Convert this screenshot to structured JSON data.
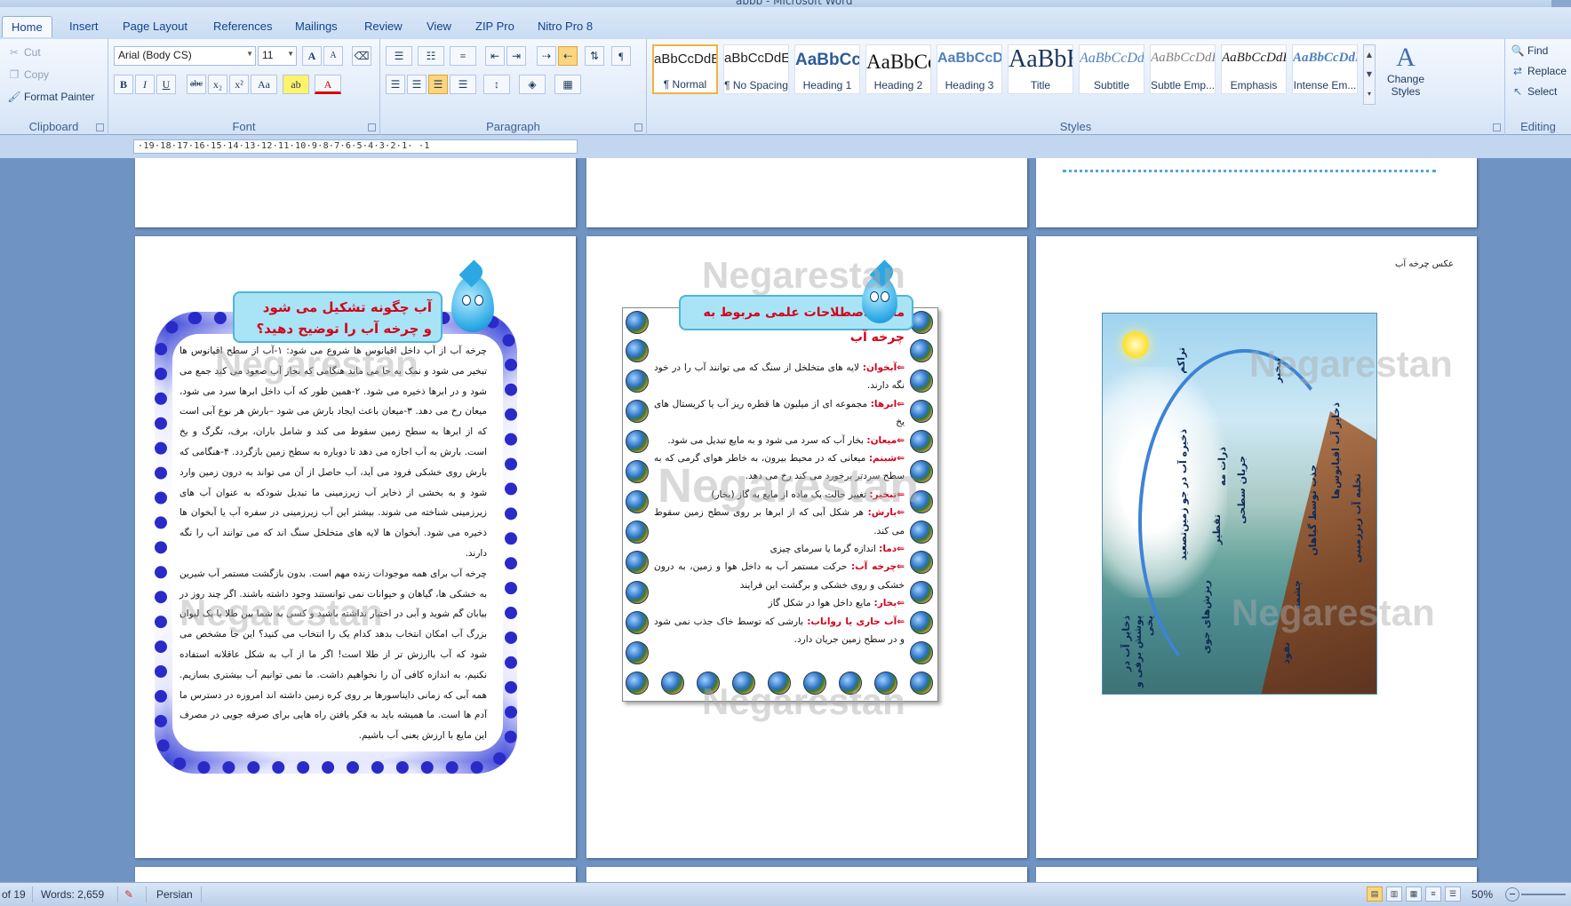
{
  "window": {
    "title": "abbb - Microsoft Word"
  },
  "tabs": [
    {
      "label": "Home",
      "active": true
    },
    {
      "label": "Insert"
    },
    {
      "label": "Page Layout"
    },
    {
      "label": "References"
    },
    {
      "label": "Mailings"
    },
    {
      "label": "Review"
    },
    {
      "label": "View"
    },
    {
      "label": "ZIP Pro"
    },
    {
      "label": "Nitro Pro 8"
    }
  ],
  "clipboard": {
    "label": "Clipboard",
    "cut": "Cut",
    "copy": "Copy",
    "format_painter": "Format Painter"
  },
  "font": {
    "label": "Font",
    "name": "Arial (Body CS)",
    "size": "11",
    "grow": "A",
    "shrink": "A",
    "clear": "⌫",
    "bold": "B",
    "italic": "I",
    "underline": "U",
    "strike": "abc",
    "subscript": "x₂",
    "superscript": "x²",
    "case": "Aa",
    "highlight": "ab",
    "color": "A"
  },
  "paragraph": {
    "label": "Paragraph"
  },
  "styles": {
    "label": "Styles",
    "items": [
      {
        "sample": "aBbCcDdEe",
        "name": "¶ Normal"
      },
      {
        "sample": "aBbCcDdEe",
        "name": "¶ No Spacing"
      },
      {
        "sample": "AaBbCcDdEe",
        "name": "Heading 1"
      },
      {
        "sample": "AaBbCcDdEe",
        "name": "Heading 2"
      },
      {
        "sample": "AaBbCcDdEe",
        "name": "Heading 3"
      },
      {
        "sample": "AaBbEe",
        "name": "Title"
      },
      {
        "sample": "AaBbCcDdEe",
        "name": "Subtitle"
      },
      {
        "sample": "AaBbCcDdEe",
        "name": "Subtle Emp..."
      },
      {
        "sample": "AaBbCcDdEe",
        "name": "Emphasis"
      },
      {
        "sample": "AaBbCcDdEe",
        "name": "Intense Em..."
      }
    ],
    "change_styles": "Change Styles"
  },
  "editing": {
    "label": "Editing",
    "find": "Find",
    "replace": "Replace",
    "select": "Select"
  },
  "ruler": {
    "text": "·19·18·17·16·15·14·13·12·11·10·9·8·7·6·5·4·3·2·1· ·1"
  },
  "watermark": "Negarestan",
  "page1": {
    "title_line1": "آب چگونه تشکیل می شود",
    "title_line2": "و چرخه آب را توضیح دهید؟",
    "para1": "چرخه آب از آب داخل اقیانوس ها شروع می شود: ۱-آب از سطح اقیانوس ها تبخیر می شود و نمک به جا می ماند هنگامی که بخار آب صعود می کند جمع می شود و در ابرها ذخیره می شود. ۲-همین طور که آب داخل ابرها سرد می شود، میعان رخ می دهد. ۳-میعان باعث ایجاد بارش می شود –بارش هر نوع آبی است که از ابرها به سطح زمین سقوط می کند و شامل باران، برف، تگرگ و یخ است. بارش به آب اجازه می دهد تا دوباره به سطح زمین بازگردد. ۴-هنگامی که بارش روی خشکی فرود می آید، آب حاصل از آن می تواند به درون زمین وارد شود و به بخشی از ذخایر آب زیرزمینی ما تبدیل شودکه به عنوان آب های زیرزمینی شناخته می شوند. بیشتر این آب زیرزمینی در سفره آب یا آبخوان ها ذخیره می شود. آبخوان ها لایه های متخلخل سنگ اند که می توانند آب را نگه دارند.",
    "para2": "چرخه آب برای همه موجودات زنده مهم است. بدون بازگشت مستمر آب شیرین به خشکی ها، گیاهان و حیوانات نمی توانستند وجود داشته باشند. اگر چند روز در بیابان گم شوید و آبی در اختیار نداشته باشید و کسی به شما بین طلا یا یک لیوان بزرگ آب امکان انتخاب بدهد کدام یک را انتخاب می کنید؟ این جا مشخص می شود که آب باارزش تر از طلا است! اگر ما از آب به شکل عاقلانه استفاده نکنیم، به اندازه کافی آن را نخواهیم داشت. ما نمی توانیم آب بیشتری بسازیم. همه آبی که زمانی دایناسورها بر روی کره زمین داشته اند امروزه در دسترس ما آدم ها است. ما همیشه باید به فکر یافتن راه هایی برای صرفه جویی در مصرف این مایع با ارزش یعنی آب باشیم."
  },
  "page2": {
    "title": "معنی اصطلاحات علمی مربوط به چرخه آب",
    "terms": [
      {
        "term": "⇐آبخوان:",
        "def": " لایه های متخلخل از سنگ که می توانند آب را در خود نگه دارند."
      },
      {
        "term": "⇐ابرها:",
        "def": " مجموعه ای از میلیون ها قطره ریز آب یا کریستال های یخ"
      },
      {
        "term": "⇐میعان:",
        "def": " بخار آب که سرد می شود و به مایع تبدیل می شود."
      },
      {
        "term": "⇐شبنم:",
        "def": " میعانی که در محیط بیرون، به خاطر هوای گرمی که به سطح سردتر برخورد می کند رخ می دهد."
      },
      {
        "term": "⇐تبخیر:",
        "def": " تغییر حالت یک ماده از مایع به گاز (بخار)"
      },
      {
        "term": "⇐بارش:",
        "def": " هر شکل آبی که از ابرها بر روی سطح زمین سقوط می کند."
      },
      {
        "term": "⇐دما:",
        "def": " اندازه گرما یا سرمای چیزی"
      },
      {
        "term": "⇐چرخه آب:",
        "def": " حرکت مستمر آب به داخل هوا و زمین، به درون خشکی و روی خشکی و برگشت این فرایند"
      },
      {
        "term": "⇐بخار:",
        "def": " مایع داخل هوا در شکل گاز"
      },
      {
        "term": "⇐آب جاری یا رواناب:",
        "def": " بارشی که توسط خاک جذب نمی شود و در سطح زمین جریان دارد."
      }
    ]
  },
  "page3": {
    "caption": "عکس چرخه آب",
    "labels": [
      "تراکم",
      "ذخیره آب در جو زمین",
      "ذرات مه",
      "تبخیر",
      "تصعید",
      "تقطیر",
      "جریان سطحی",
      "ذخایر آب اقیانوس‌ها",
      "جذب توسط گیاهان",
      "تخلیه آب زیرزمینی",
      "ذخایر آب در پوشش برفی و یخی",
      "ریزش‌های جوی",
      "چشمه",
      "نفوذ"
    ]
  },
  "status": {
    "page": "of 19",
    "words": "Words: 2,659",
    "language": "Persian",
    "zoom": "50%"
  }
}
